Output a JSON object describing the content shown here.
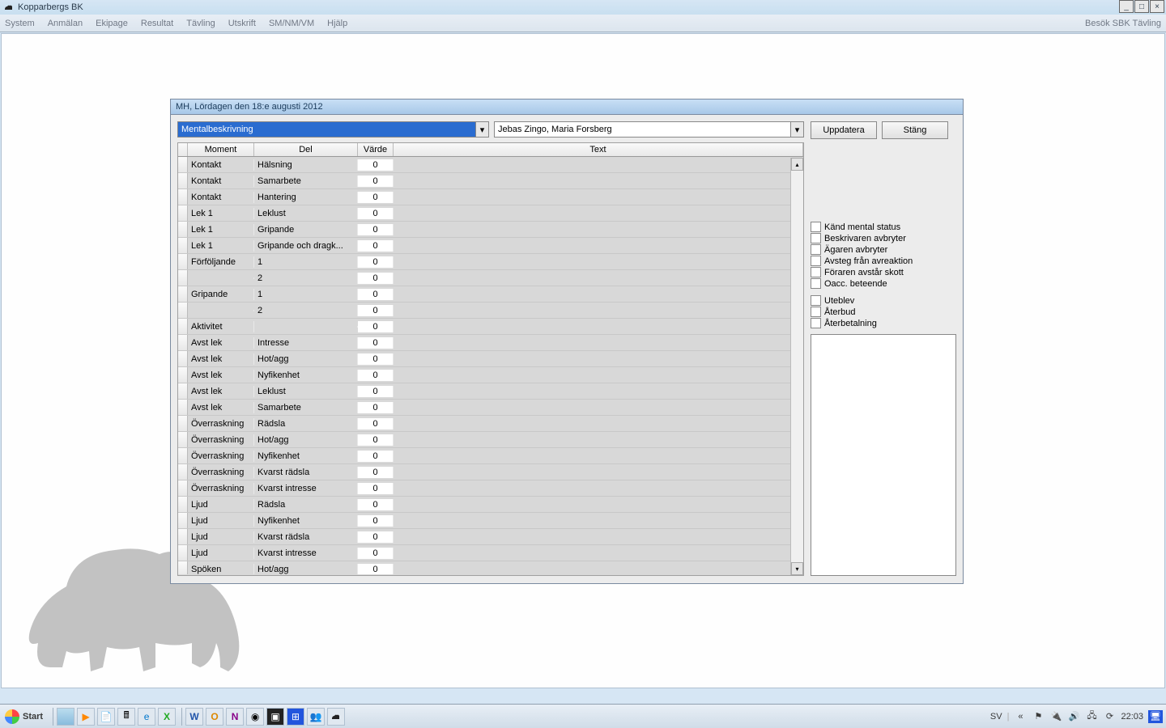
{
  "app": {
    "title": "Kopparbergs BK"
  },
  "menu": {
    "items": [
      "System",
      "Anmälan",
      "Ekipage",
      "Resultat",
      "Tävling",
      "Utskrift",
      "SM/NM/VM",
      "Hjälp"
    ],
    "right": "Besök SBK Tävling"
  },
  "dialog": {
    "title": "MH, Lördagen den 18:e augusti 2012",
    "dropdown1": "Mentalbeskrivning",
    "dropdown2": "Jebas Zingo, Maria Forsberg",
    "btn_update": "Uppdatera",
    "btn_close": "Stäng",
    "cols": {
      "moment": "Moment",
      "del": "Del",
      "varde": "Värde",
      "text": "Text"
    },
    "rows": [
      {
        "moment": "Kontakt",
        "del": "Hälsning",
        "varde": "0",
        "text": ""
      },
      {
        "moment": "Kontakt",
        "del": "Samarbete",
        "varde": "0",
        "text": ""
      },
      {
        "moment": "Kontakt",
        "del": "Hantering",
        "varde": "0",
        "text": ""
      },
      {
        "moment": "Lek 1",
        "del": "Leklust",
        "varde": "0",
        "text": ""
      },
      {
        "moment": "Lek 1",
        "del": "Gripande",
        "varde": "0",
        "text": ""
      },
      {
        "moment": "Lek 1",
        "del": "Gripande och dragk...",
        "varde": "0",
        "text": ""
      },
      {
        "moment": "Förföljande",
        "del": "1",
        "varde": "0",
        "text": ""
      },
      {
        "moment": "",
        "del": "2",
        "varde": "0",
        "text": ""
      },
      {
        "moment": "Gripande",
        "del": "1",
        "varde": "0",
        "text": ""
      },
      {
        "moment": "",
        "del": "2",
        "varde": "0",
        "text": ""
      },
      {
        "moment": "Aktivitet",
        "del": "",
        "varde": "0",
        "text": ""
      },
      {
        "moment": "Avst lek",
        "del": "Intresse",
        "varde": "0",
        "text": ""
      },
      {
        "moment": "Avst lek",
        "del": "Hot/agg",
        "varde": "0",
        "text": ""
      },
      {
        "moment": "Avst lek",
        "del": "Nyfikenhet",
        "varde": "0",
        "text": ""
      },
      {
        "moment": "Avst lek",
        "del": "Leklust",
        "varde": "0",
        "text": ""
      },
      {
        "moment": "Avst lek",
        "del": "Samarbete",
        "varde": "0",
        "text": ""
      },
      {
        "moment": "Överraskning",
        "del": "Rädsla",
        "varde": "0",
        "text": ""
      },
      {
        "moment": "Överraskning",
        "del": "Hot/agg",
        "varde": "0",
        "text": ""
      },
      {
        "moment": "Överraskning",
        "del": "Nyfikenhet",
        "varde": "0",
        "text": ""
      },
      {
        "moment": "Överraskning",
        "del": "Kvarst rädsla",
        "varde": "0",
        "text": ""
      },
      {
        "moment": "Överraskning",
        "del": "Kvarst intresse",
        "varde": "0",
        "text": ""
      },
      {
        "moment": "Ljud",
        "del": "Rädsla",
        "varde": "0",
        "text": ""
      },
      {
        "moment": "Ljud",
        "del": "Nyfikenhet",
        "varde": "0",
        "text": ""
      },
      {
        "moment": "Ljud",
        "del": "Kvarst rädsla",
        "varde": "0",
        "text": ""
      },
      {
        "moment": "Ljud",
        "del": "Kvarst intresse",
        "varde": "0",
        "text": ""
      },
      {
        "moment": "Spöken",
        "del": "Hot/agg",
        "varde": "0",
        "text": ""
      }
    ],
    "checkboxes": [
      "Känd mental status",
      "Beskrivaren avbryter",
      "Ägaren avbryter",
      "Avsteg från avreaktion",
      "Föraren avstår skott",
      "Oacc. beteende",
      "Uteblev",
      "Återbud",
      "Återbetalning"
    ]
  },
  "taskbar": {
    "start": "Start",
    "lang": "SV",
    "time": "22:03"
  }
}
